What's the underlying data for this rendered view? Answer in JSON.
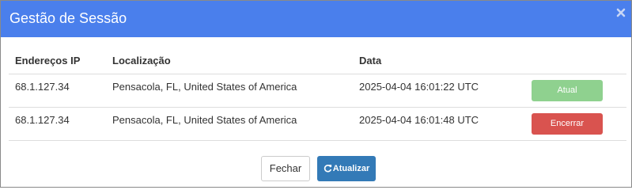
{
  "modal": {
    "title": "Gestão de Sessão",
    "close_icon": "close-icon"
  },
  "table": {
    "headers": [
      "Endereços IP",
      "Localização",
      "Data"
    ],
    "rows": [
      {
        "ip": "68.1.127.34",
        "location": "Pensacola, FL, United States of America",
        "date": "2025-04-04 16:01:22 UTC",
        "action": "Atual"
      },
      {
        "ip": "68.1.127.34",
        "location": "Pensacola, FL, United States of America",
        "date": "2025-04-04 16:01:48 UTC",
        "action": "Encerrar"
      }
    ]
  },
  "footer": {
    "close_label": "Fechar",
    "refresh_label": "Atualizar",
    "refresh_icon": "refresh-icon"
  },
  "colors": {
    "header_bg": "#4a7fec",
    "current_btn": "#8fd18f",
    "end_btn": "#d9534f",
    "refresh_btn": "#337ab7"
  }
}
